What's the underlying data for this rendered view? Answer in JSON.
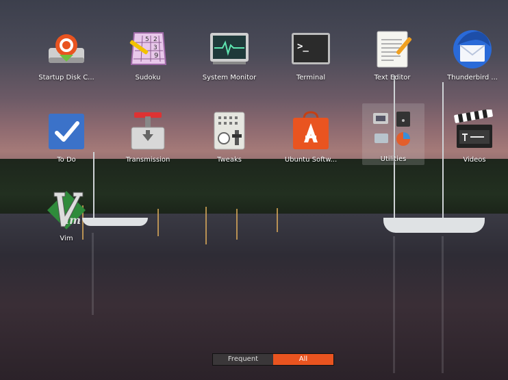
{
  "apps": [
    {
      "label": "Startup Disk C...",
      "icon": "startup-disk-creator-icon"
    },
    {
      "label": "Sudoku",
      "icon": "sudoku-icon",
      "grid": [
        "5",
        "2",
        "3",
        "9"
      ]
    },
    {
      "label": "System Monitor",
      "icon": "system-monitor-icon"
    },
    {
      "label": "Terminal",
      "icon": "terminal-icon",
      "prompt": ">_"
    },
    {
      "label": "Text Editor",
      "icon": "text-editor-icon"
    },
    {
      "label": "Thunderbird ...",
      "icon": "thunderbird-icon"
    },
    {
      "label": "To Do",
      "icon": "todo-icon"
    },
    {
      "label": "Transmission",
      "icon": "transmission-icon"
    },
    {
      "label": "Tweaks",
      "icon": "tweaks-icon"
    },
    {
      "label": "Ubuntu Softw...",
      "icon": "ubuntu-software-icon"
    },
    {
      "label": "Utilities",
      "icon": "utilities-folder-icon"
    },
    {
      "label": "Videos",
      "icon": "videos-icon"
    },
    {
      "label": "Vim",
      "icon": "vim-icon",
      "logo_text": "im"
    }
  ],
  "switcher": {
    "frequent": "Frequent",
    "all": "All",
    "active": "all"
  },
  "colors": {
    "accent": "#e95420",
    "inactive_tab": "#3a3739"
  }
}
